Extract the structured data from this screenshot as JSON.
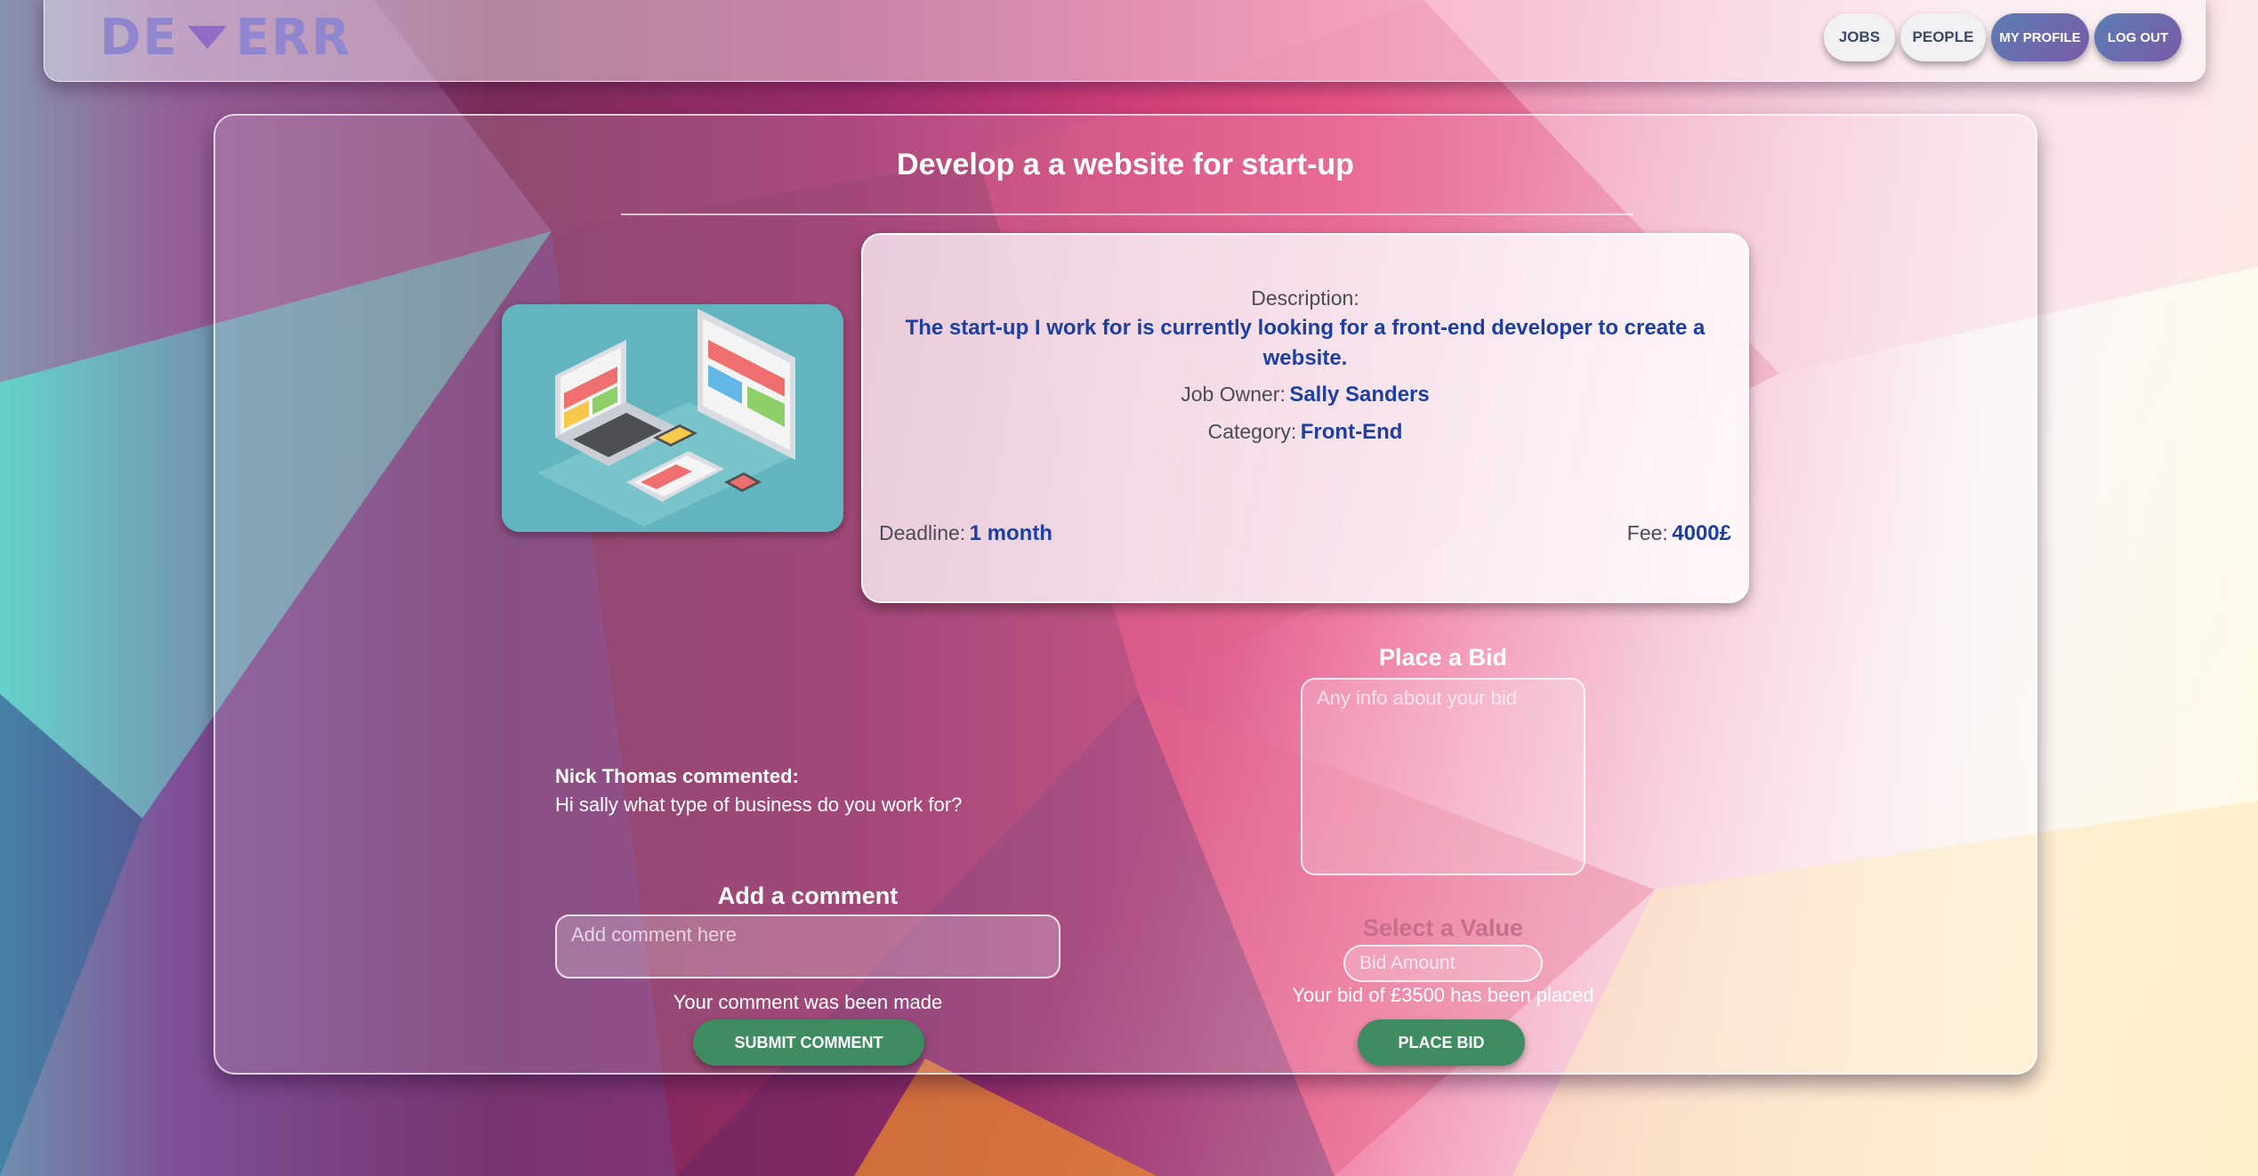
{
  "nav": {
    "logo_left": "DE",
    "logo_right": "ERR",
    "jobs": "JOBS",
    "people": "PEOPLE",
    "my_profile": "MY PROFILE",
    "log_out": "LOG OUT"
  },
  "job": {
    "title": "Develop a a website for start-up",
    "description_label": "Description:",
    "description": "The start-up I work for is currently looking for a front-end developer to create a website.",
    "owner_label": "Job Owner:",
    "owner": "Sally Sanders",
    "category_label": "Category:",
    "category": "Front-End",
    "deadline_label": "Deadline:",
    "deadline": "1 month",
    "fee_label": "Fee:",
    "fee": "4000£",
    "image_icon": "laptop-devices-illustration"
  },
  "comments": {
    "items": [
      {
        "author": "Nick Thomas commented:",
        "text": "Hi sally what type of business do you work for?"
      }
    ],
    "add_title": "Add a comment",
    "placeholder": "Add comment here",
    "status": "Your comment was been made",
    "submit_label": "SUBMIT COMMENT"
  },
  "bid": {
    "title": "Place a Bid",
    "info_placeholder": "Any info about your bid",
    "value_title": "Select a Value",
    "amount_placeholder": "Bid Amount",
    "status": "Your bid of £3500 has been placed",
    "button_label": "PLACE BID"
  },
  "colors": {
    "accent_blue": "#1c3fa3",
    "button_green": "#3e8c60",
    "logo_purple": "#8f86cf"
  }
}
